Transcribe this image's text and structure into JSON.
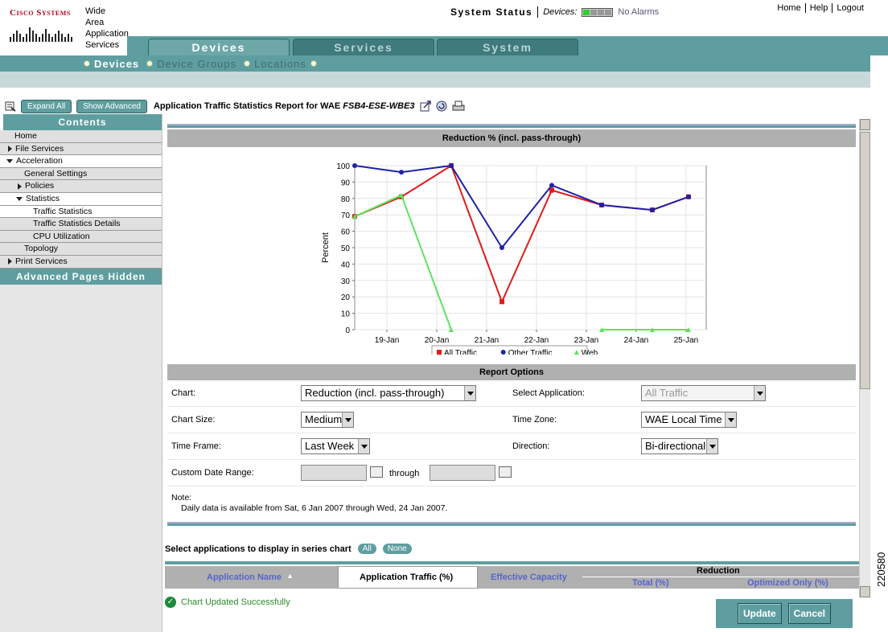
{
  "header": {
    "logo_text": "Cisco Systems",
    "product_name": [
      "Wide",
      "Area",
      "Application",
      "Services"
    ],
    "system_status_label": "System Status",
    "devices_label": "Devices:",
    "alarms_text": "No Alarms",
    "links": [
      "Home",
      "Help",
      "Logout"
    ]
  },
  "tabs": [
    "Devices",
    "Services",
    "System"
  ],
  "subnav": [
    "Devices",
    "Device Groups",
    "Locations"
  ],
  "toolbar": {
    "expand_all": "Expand All",
    "show_advanced": "Show Advanced",
    "report_title_prefix": "Application Traffic Statistics Report for WAE ",
    "report_title_device": "FSB4-ESE-WBE3"
  },
  "sidebar": {
    "header": "Contents",
    "items": [
      {
        "label": "Home"
      },
      {
        "label": "File Services"
      },
      {
        "label": "Acceleration"
      },
      {
        "label": "General Settings"
      },
      {
        "label": "Policies"
      },
      {
        "label": "Statistics"
      },
      {
        "label": "Traffic Statistics"
      },
      {
        "label": "Traffic Statistics Details"
      },
      {
        "label": "CPU Utilization"
      },
      {
        "label": "Topology"
      },
      {
        "label": "Print Services"
      }
    ],
    "footer": "Advanced Pages Hidden"
  },
  "chart_data": {
    "type": "line",
    "title": "Reduction % (incl. pass-through)",
    "xlabel": "",
    "ylabel": "Percent",
    "ylim": [
      0,
      100
    ],
    "yticks": [
      0,
      10,
      20,
      30,
      40,
      50,
      60,
      70,
      80,
      90,
      100
    ],
    "categories": [
      "19-Jan",
      "20-Jan",
      "21-Jan",
      "22-Jan",
      "23-Jan",
      "24-Jan",
      "25-Jan"
    ],
    "x": [
      "18-Jan 12:00",
      "19-Jan 06:00",
      "20-Jan 06:00",
      "21-Jan 06:00",
      "22-Jan 06:00",
      "23-Jan 06:00",
      "24-Jan 06:00",
      "25-Jan 06:00"
    ],
    "series": [
      {
        "name": "All Traffic",
        "color": "#e21a1a",
        "values": [
          69,
          81,
          100,
          17,
          85,
          76,
          73,
          81
        ]
      },
      {
        "name": "Other Traffic",
        "color": "#1f22a8",
        "values": [
          100,
          96,
          100,
          50,
          88,
          76,
          73,
          81
        ]
      },
      {
        "name": "Web",
        "color": "#5ee35e",
        "values": [
          69,
          82,
          0,
          null,
          null,
          0,
          0,
          0
        ]
      }
    ],
    "grid": true,
    "legend": "bottom"
  },
  "options": {
    "header": "Report Options",
    "chart_label": "Chart:",
    "chart_value": "Reduction (incl. pass-through)",
    "select_app_label": "Select Application:",
    "select_app_value": "All Traffic",
    "chart_size_label": "Chart Size:",
    "chart_size_value": "Medium",
    "time_zone_label": "Time Zone:",
    "time_zone_value": "WAE Local Time",
    "time_frame_label": "Time Frame:",
    "time_frame_value": "Last Week",
    "direction_label": "Direction:",
    "direction_value": "Bi-directional",
    "custom_range_label": "Custom Date Range:",
    "through_label": "through",
    "note_label": "Note:",
    "note_text": "Daily data is available from Sat, 6 Jan 2007 through Wed, 24 Jan 2007."
  },
  "series_select": {
    "label": "Select applications to display in series chart",
    "all": "All",
    "none": "None"
  },
  "table": {
    "col_app_name": "Application Name",
    "col_app_traffic": "Application Traffic (%)",
    "col_eff_capacity": "Effective Capacity",
    "col_reduction": "Reduction",
    "col_total": "Total (%)",
    "col_optimized": "Optimized Only (%)"
  },
  "status": {
    "message": "Chart Updated Successfully"
  },
  "buttons": {
    "update": "Update",
    "cancel": "Cancel"
  },
  "figure_number": "220580"
}
